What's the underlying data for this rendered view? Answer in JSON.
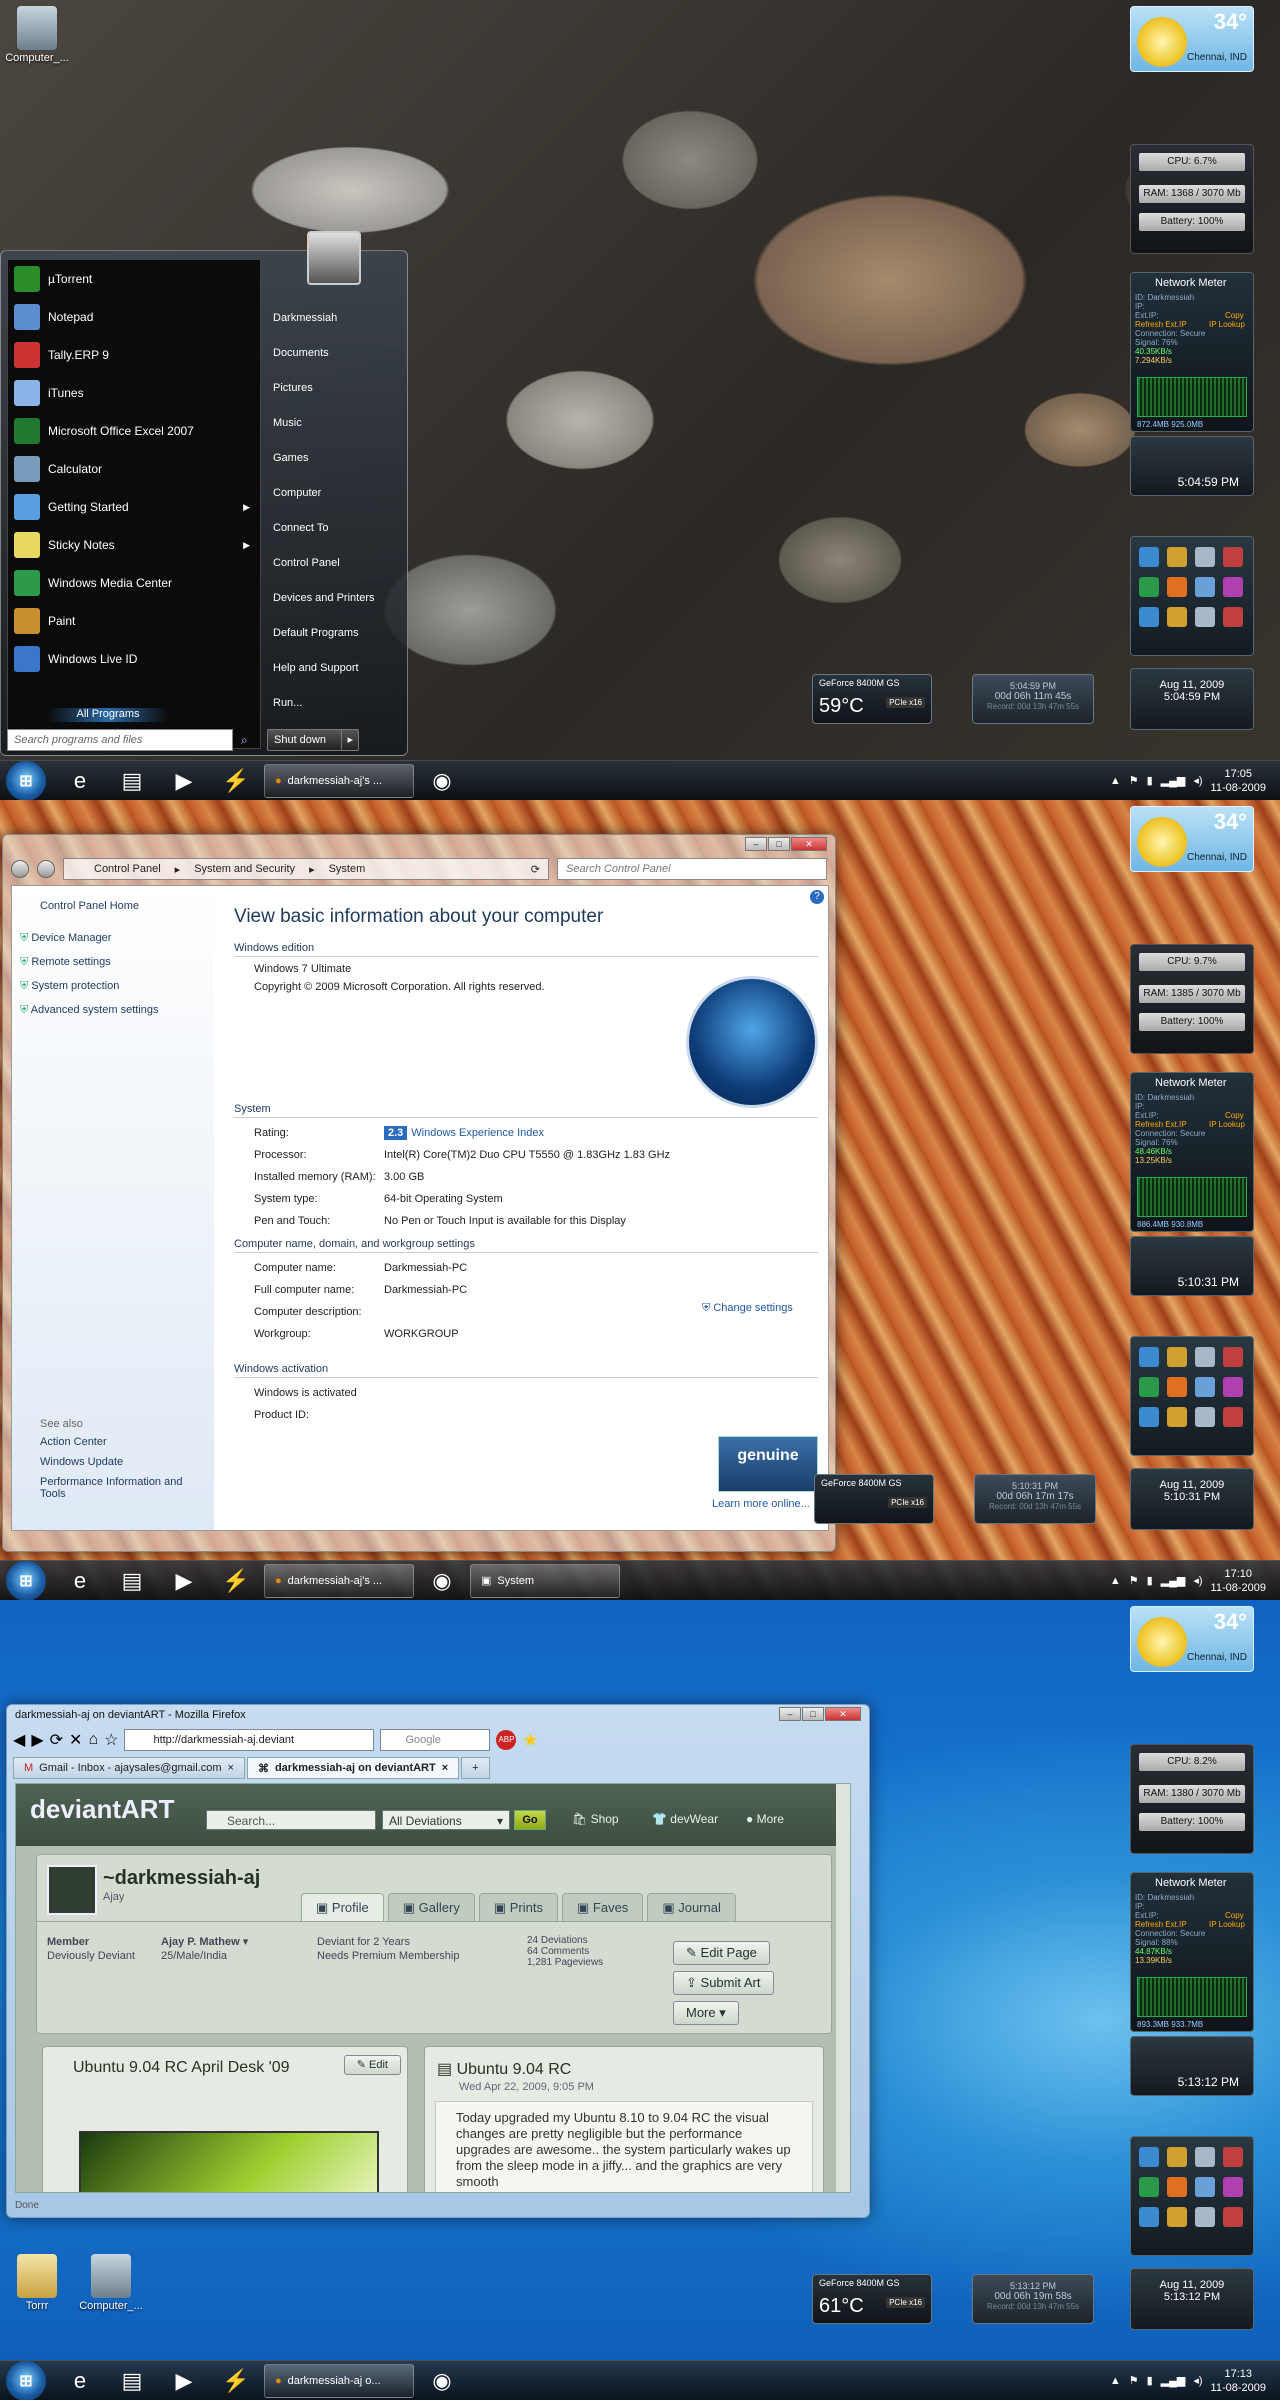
{
  "screen1": {
    "desktop_icon": "Computer_...",
    "start_menu": {
      "user": "Darkmessiah",
      "programs": [
        {
          "label": "µTorrent",
          "icon": "utorrent-icon",
          "color": "#2a8d2a"
        },
        {
          "label": "Notepad",
          "icon": "notepad-icon",
          "color": "#5b8fd0"
        },
        {
          "label": "Tally.ERP 9",
          "icon": "tally-icon",
          "color": "#c33"
        },
        {
          "label": "iTunes",
          "icon": "itunes-icon",
          "color": "#8ab4e8"
        },
        {
          "label": "Microsoft Office Excel 2007",
          "icon": "excel-icon",
          "color": "#1f7a2f"
        },
        {
          "label": "Calculator",
          "icon": "calculator-icon",
          "color": "#7a9cbd"
        },
        {
          "label": "Getting Started",
          "icon": "getting-started-icon",
          "color": "#5aa0e0",
          "arrow": "▶"
        },
        {
          "label": "Sticky Notes",
          "icon": "sticky-notes-icon",
          "color": "#e8d760",
          "arrow": "▶"
        },
        {
          "label": "Windows Media Center",
          "icon": "media-center-icon",
          "color": "#2d9a4a"
        },
        {
          "label": "Paint",
          "icon": "paint-icon",
          "color": "#c99030"
        },
        {
          "label": "Windows Live ID",
          "icon": "live-id-icon",
          "color": "#3a77c8"
        }
      ],
      "all_programs": "All Programs",
      "search_placeholder": "Search programs and files",
      "right": [
        "Darkmessiah",
        "Documents",
        "Pictures",
        "Music",
        "Games",
        "Computer",
        "Connect To",
        "Control Panel",
        "Devices and Printers",
        "Default Programs",
        "Help and Support",
        "Run..."
      ],
      "shutdown": "Shut down"
    },
    "weather": {
      "temp": "34°",
      "city": "Chennai, IND"
    },
    "cpu": {
      "cpu": "CPU: 6.7%",
      "ram": "RAM: 1368 / 3070 Mb",
      "battery": "Battery: 100%"
    },
    "net": {
      "title": "Network Meter",
      "lines": [
        "ID: Darkmessiah",
        "IP:",
        "Ext.IP:",
        "Refresh Ext.IP",
        "Connection: Secure",
        "Signal: 76%",
        "40.35KB/s",
        "7.294KB/s"
      ],
      "copy": "Copy",
      "lookup": "IP Lookup",
      "foot": "872.4MB   925.0MB"
    },
    "clock": "5:04:59 PM",
    "gpu": {
      "name": "GeForce 8400M GS",
      "temp": "59°C",
      "bus": "PCIe x16"
    },
    "uptime": {
      "time": "5:04:59 PM",
      "up": "00d 06h 11m 45s",
      "record": "Record: 00d 13h 47m 55s"
    },
    "date": {
      "date": "Aug 11, 2009",
      "time": "5:04:59 PM"
    },
    "taskbar": {
      "task": "darkmessiah-aj's ...",
      "time": "17:05",
      "date": "11-08-2009"
    }
  },
  "screen2": {
    "weather": {
      "temp": "34°",
      "city": "Chennai, IND"
    },
    "cpu": {
      "cpu": "CPU: 9.7%",
      "ram": "RAM: 1385 / 3070 Mb",
      "battery": "Battery: 100%"
    },
    "net": {
      "title": "Network Meter",
      "lines": [
        "ID: Darkmessiah",
        "IP:",
        "Ext.IP:",
        "Refresh Ext.IP",
        "Connection: Secure",
        "Signal: 76%",
        "48.46KB/s",
        "13.25KB/s"
      ],
      "copy": "Copy",
      "lookup": "IP Lookup",
      "foot": "886.4MB   930.8MB"
    },
    "clock": "5:10:31 PM",
    "gpu": {
      "name": "GeForce 8400M GS",
      "bus": "PCIe x16"
    },
    "uptime": {
      "time": "5:10:31 PM",
      "up": "00d 06h 17m 17s",
      "record": "Record: 00d 13h 47m 55s"
    },
    "date": {
      "date": "Aug 11, 2009",
      "time": "5:10:31 PM"
    },
    "control_panel": {
      "path": [
        "Control Panel",
        "System and Security",
        "System"
      ],
      "search_placeholder": "Search Control Panel",
      "side": [
        "Control Panel Home",
        "Device Manager",
        "Remote settings",
        "System protection",
        "Advanced system settings"
      ],
      "see_also": "See also",
      "see_also_links": [
        "Action Center",
        "Windows Update",
        "Performance Information and Tools"
      ],
      "heading": "View basic information about your computer",
      "edition_title": "Windows edition",
      "edition": "Windows 7 Ultimate",
      "copyright": "Copyright © 2009 Microsoft Corporation.  All rights reserved.",
      "system_title": "System",
      "system_rows": [
        {
          "k": "Rating:",
          "v": "Windows Experience Index",
          "badge": "2.3"
        },
        {
          "k": "Processor:",
          "v": "Intel(R) Core(TM)2 Duo CPU     T5550  @ 1.83GHz   1.83 GHz"
        },
        {
          "k": "Installed memory (RAM):",
          "v": "3.00 GB"
        },
        {
          "k": "System type:",
          "v": "64-bit Operating System"
        },
        {
          "k": "Pen and Touch:",
          "v": "No Pen or Touch Input is available for this Display"
        }
      ],
      "name_title": "Computer name, domain, and workgroup settings",
      "name_rows": [
        {
          "k": "Computer name:",
          "v": "Darkmessiah-PC"
        },
        {
          "k": "Full computer name:",
          "v": "Darkmessiah-PC"
        },
        {
          "k": "Computer description:",
          "v": ""
        },
        {
          "k": "Workgroup:",
          "v": "WORKGROUP"
        }
      ],
      "change_settings": "Change settings",
      "activation_title": "Windows activation",
      "activation_rows": [
        {
          "k": "Windows is activated",
          "v": ""
        },
        {
          "k": "Product ID:",
          "v": ""
        }
      ],
      "genuine": "genuine",
      "learn_more": "Learn more online..."
    },
    "taskbar": {
      "task": "darkmessiah-aj's ...",
      "task2": "System",
      "time": "17:10",
      "date": "11-08-2009"
    }
  },
  "screen3": {
    "weather": {
      "temp": "34°",
      "city": "Chennai, IND"
    },
    "cpu": {
      "cpu": "CPU: 8.2%",
      "ram": "RAM: 1380 / 3070 Mb",
      "battery": "Battery: 100%"
    },
    "net": {
      "title": "Network Meter",
      "lines": [
        "ID: Darkmessiah",
        "IP:",
        "Ext.IP:",
        "Refresh Ext.IP",
        "Connection: Secure",
        "Signal: 88%",
        "44.87KB/s",
        "13.39KB/s"
      ],
      "copy": "Copy",
      "lookup": "IP Lookup",
      "foot": "893.3MB   933.7MB"
    },
    "clock": "5:13:12 PM",
    "gpu": {
      "name": "GeForce 8400M GS",
      "temp": "61°C",
      "bus": "PCIe x16"
    },
    "uptime": {
      "time": "5:13:12 PM",
      "up": "00d 06h 19m 58s",
      "record": "Record: 00d 13h 47m 55s"
    },
    "date": {
      "date": "Aug 11, 2009",
      "time": "5:13:12 PM"
    },
    "desktop_icons": [
      "Torrr",
      "Computer_..."
    ],
    "firefox": {
      "title": "darkmessiah-aj on deviantART - Mozilla Firefox",
      "url": "http://darkmessiah-aj.deviant",
      "search_placeholder": "Google",
      "tabs": [
        "Gmail - Inbox - ajaysales@gmail.com",
        "darkmessiah-aj on deviantART"
      ],
      "status": "Done",
      "da": {
        "logo": "deviantART",
        "search_placeholder": "Search...",
        "select": "All Deviations",
        "go": "Go",
        "menu": [
          "Shop",
          "devWear",
          "More"
        ],
        "username": "~darkmessiah-aj",
        "realname": "Ajay",
        "tabs": [
          "Profile",
          "Gallery",
          "Prints",
          "Faves",
          "Journal"
        ],
        "member": "Member",
        "member_type": "Deviously Deviant",
        "person": "Ajay P. Mathew",
        "person_info": "25/Male/India",
        "deviant_for": "Deviant for 2 Years",
        "membership": "Needs Premium Membership",
        "stats": [
          "24 Deviations",
          "64 Comments",
          "1,281 Pageviews"
        ],
        "buttons": [
          "Edit Page",
          "Submit Art",
          "More"
        ],
        "card1": {
          "title": "Ubuntu 9.04 RC April Desk '09",
          "edit": "Edit"
        },
        "card2": {
          "title": "Ubuntu 9.04 RC",
          "date": "Wed Apr 22, 2009, 9:05 PM",
          "body": "Today upgraded my Ubuntu 8.10 to 9.04 RC the visual changes are pretty negligible but the performance upgrades are awesome.. the system particularly wakes up from the sleep mode in a jiffy... and the graphics are very smooth"
        }
      }
    },
    "taskbar": {
      "task": "darkmessiah-aj o...",
      "time": "17:13",
      "date": "11-08-2009"
    }
  }
}
